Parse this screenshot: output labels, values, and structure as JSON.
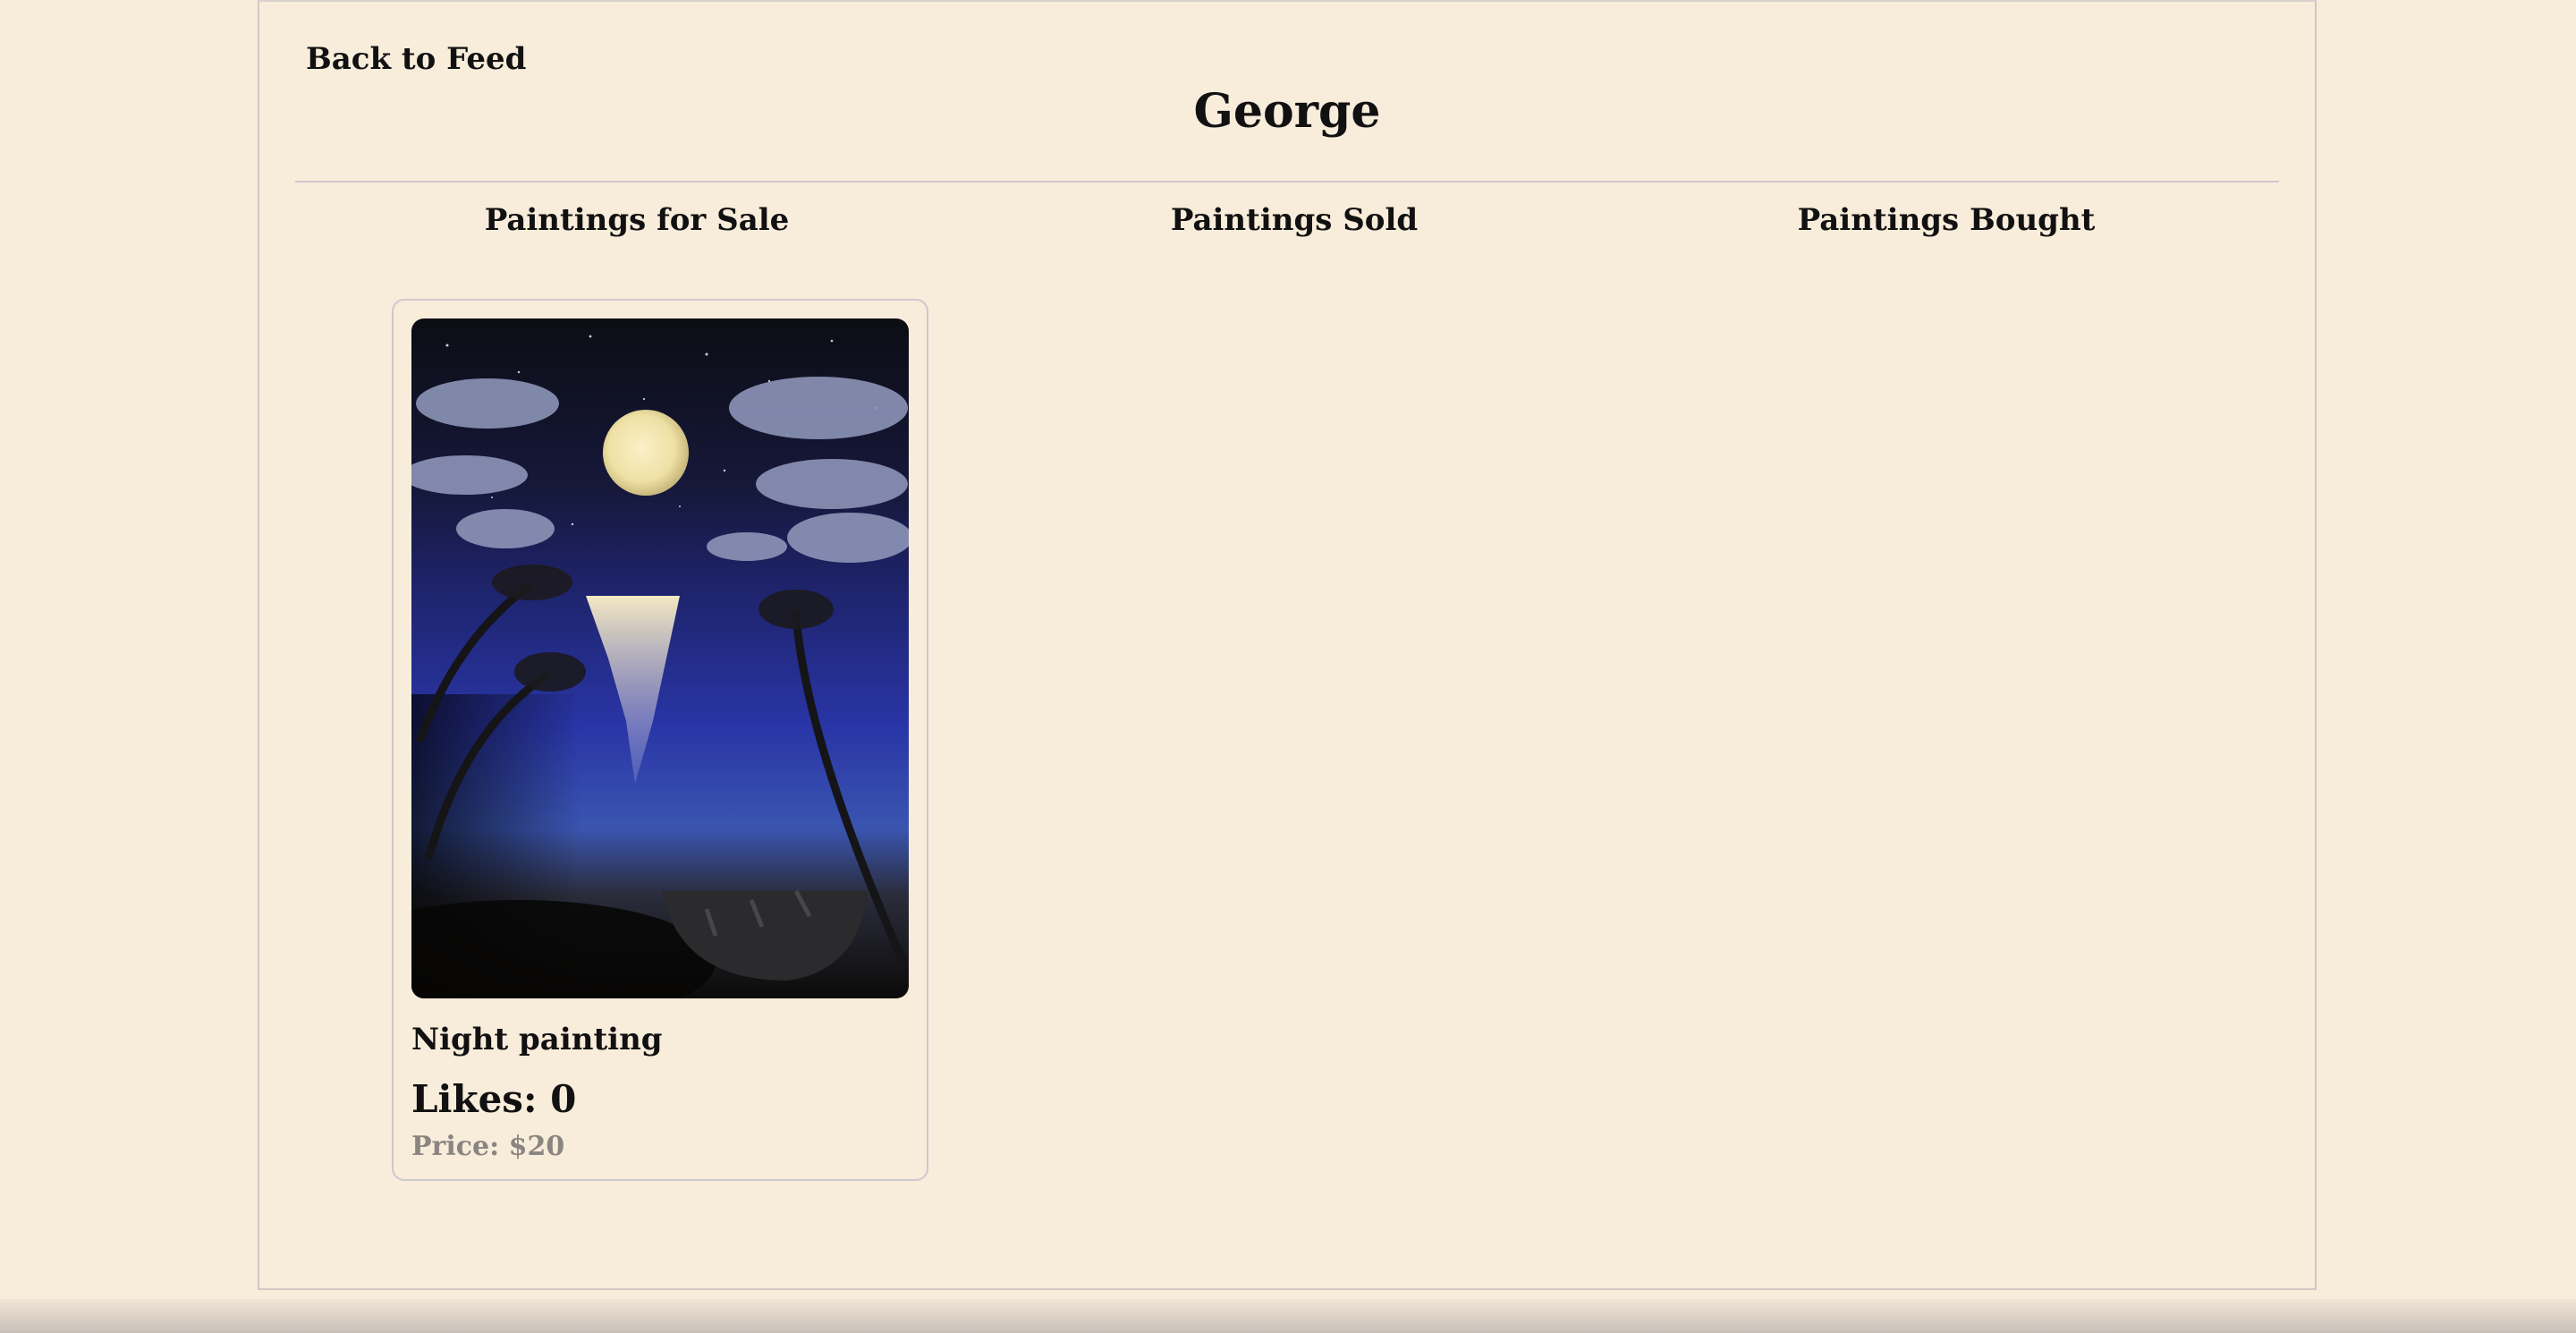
{
  "nav": {
    "back_label": "Back to Feed"
  },
  "profile": {
    "name": "George"
  },
  "tabs": [
    {
      "label": "Paintings for Sale"
    },
    {
      "label": "Paintings Sold"
    },
    {
      "label": "Paintings Bought"
    }
  ],
  "paintings": [
    {
      "title": "Night painting",
      "likes_text": "Likes: 0",
      "price_text": "Price: $20"
    }
  ],
  "colors": {
    "background": "#f8ecdb",
    "border": "#cfc8cc",
    "text": "#111111",
    "price_text": "#8a8580"
  }
}
